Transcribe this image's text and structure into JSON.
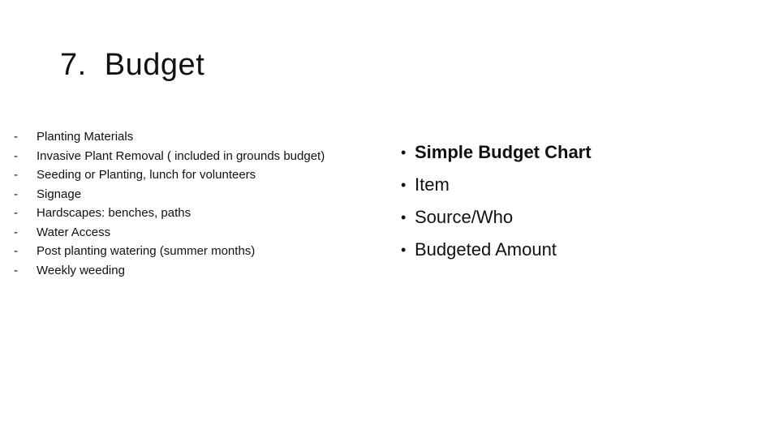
{
  "slide": {
    "title": "7.  Budget",
    "left_list": {
      "marker": "-",
      "items": [
        "Planting Materials",
        "Invasive Plant Removal ( included in grounds budget)",
        "Seeding or Planting, lunch for volunteers",
        "Signage",
        "Hardscapes: benches, paths",
        "Water Access",
        "Post planting watering (summer months)",
        "Weekly weeding"
      ]
    },
    "right_list": {
      "marker": "•",
      "items": [
        {
          "label": "Simple Budget Chart",
          "bold": true
        },
        {
          "label": "Item",
          "bold": false
        },
        {
          "label": "Source/Who",
          "bold": false
        },
        {
          "label": "Budgeted Amount",
          "bold": false
        }
      ]
    }
  }
}
